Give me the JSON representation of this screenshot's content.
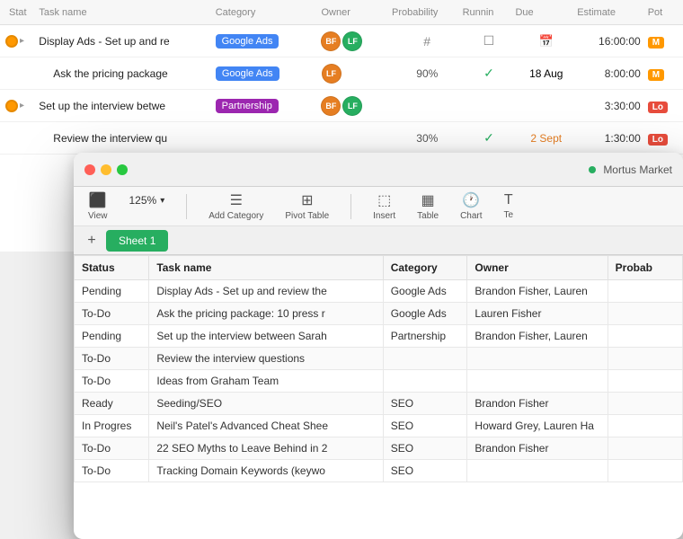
{
  "taskManager": {
    "headers": {
      "status": "Stat",
      "taskName": "Task name",
      "category": "Category",
      "owner": "Owner",
      "probability": "Probability",
      "running": "Runnin",
      "due": "Due",
      "estimate": "Estimate",
      "pot": "Pot"
    },
    "rows": [
      {
        "status": "orange",
        "indent": false,
        "name": "Display Ads - Set up and re",
        "category": "Google Ads",
        "categoryType": "google",
        "hasOwner": true,
        "ownerType": "two",
        "probability": "#",
        "running": "square",
        "due": "cal",
        "estimate": "16:00:00",
        "potType": "orange"
      },
      {
        "status": null,
        "indent": true,
        "name": "Ask the pricing package",
        "category": "Google Ads",
        "categoryType": "google",
        "hasOwner": true,
        "ownerType": "single-orange",
        "probability": "90%",
        "running": "check",
        "due": "18 Aug",
        "dueColor": "normal",
        "estimate": "8:00:00",
        "potType": "orange"
      },
      {
        "status": "orange",
        "indent": false,
        "name": "Set up the interview betwe",
        "category": "Partnership",
        "categoryType": "partnership",
        "hasOwner": true,
        "ownerType": "two",
        "probability": null,
        "running": null,
        "due": null,
        "estimate": "3:30:00",
        "potType": "red"
      },
      {
        "status": null,
        "indent": true,
        "name": "Review the interview qu",
        "category": null,
        "categoryType": null,
        "hasOwner": false,
        "ownerType": null,
        "probability": "30%",
        "running": "check",
        "due": "2 Sept",
        "dueColor": "orange",
        "estimate": "1:30:00",
        "potType": "red"
      }
    ]
  },
  "spreadsheet": {
    "titleBar": {
      "appName": "Mortus Market"
    },
    "toolbar": {
      "viewLabel": "View",
      "zoomValue": "125%",
      "addCategoryLabel": "Add Category",
      "pivotTableLabel": "Pivot Table",
      "insertLabel": "Insert",
      "tableLabel": "Table",
      "chartLabel": "Chart",
      "textLabel": "Te"
    },
    "sheetTabs": [
      {
        "label": "Sheet 1",
        "active": true
      }
    ],
    "table": {
      "headers": [
        "Status",
        "Task name",
        "Category",
        "Owner",
        "Probab"
      ],
      "rows": [
        {
          "status": "Pending",
          "taskName": "Display Ads - Set up and review the",
          "category": "Google Ads",
          "owner": "Brandon Fisher, Lauren",
          "probability": ""
        },
        {
          "status": "To-Do",
          "taskName": "Ask the pricing package: 10 press r",
          "category": "Google Ads",
          "owner": "Lauren Fisher",
          "probability": ""
        },
        {
          "status": "Pending",
          "taskName": "Set up the interview between Sarah",
          "category": "Partnership",
          "owner": "Brandon Fisher, Lauren",
          "probability": ""
        },
        {
          "status": "To-Do",
          "taskName": "Review the interview questions",
          "category": "",
          "owner": "",
          "probability": ""
        },
        {
          "status": "To-Do",
          "taskName": "Ideas from Graham Team",
          "category": "",
          "owner": "",
          "probability": ""
        },
        {
          "status": "Ready",
          "taskName": "Seeding/SEO",
          "category": "SEO",
          "owner": "Brandon Fisher",
          "probability": ""
        },
        {
          "status": "In Progres",
          "taskName": "Neil's Patel's Advanced Cheat Shee",
          "category": "SEO",
          "owner": "Howard Grey, Lauren Ha",
          "probability": ""
        },
        {
          "status": "To-Do",
          "taskName": "22 SEO Myths to Leave Behind in 2",
          "category": "SEO",
          "owner": "Brandon Fisher",
          "probability": ""
        },
        {
          "status": "To-Do",
          "taskName": "Tracking Domain Keywords (keywo",
          "category": "SEO",
          "owner": "",
          "probability": ""
        }
      ]
    }
  }
}
